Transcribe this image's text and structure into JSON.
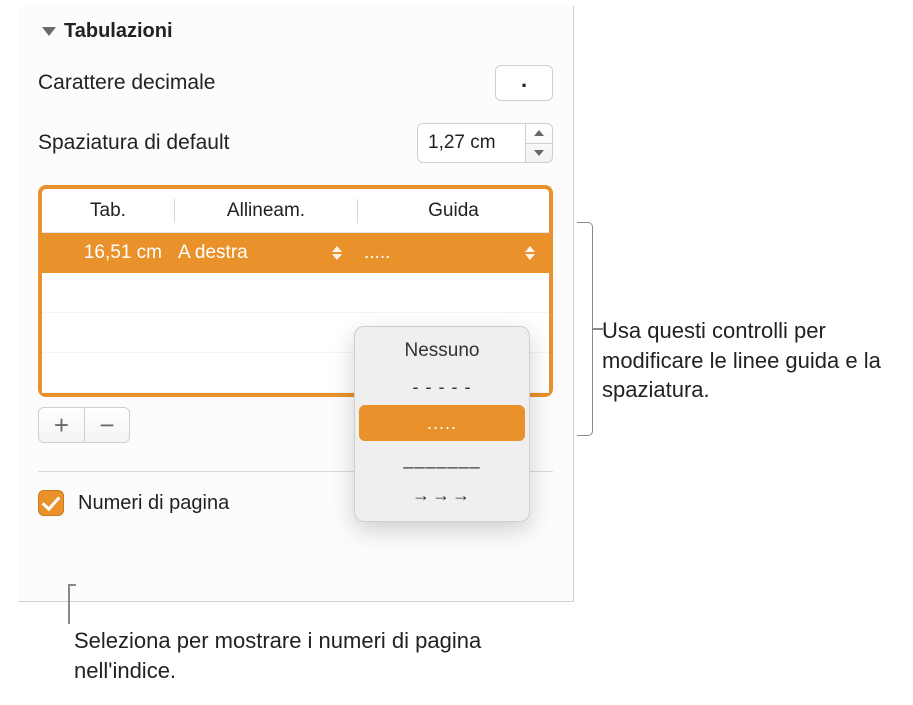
{
  "section": {
    "title": "Tabulazioni"
  },
  "decimal": {
    "label": "Carattere decimale",
    "value": "."
  },
  "spacing": {
    "label": "Spaziatura di default",
    "value": "1,27 cm"
  },
  "table": {
    "headers": {
      "tab": "Tab.",
      "align": "Allineam.",
      "leader": "Guida"
    },
    "row": {
      "stop": "16,51 cm",
      "align": "A destra",
      "leader": "....."
    }
  },
  "leader_options": {
    "none": "Nessuno",
    "dashes": "- - - - -",
    "dots": ".....",
    "underscore": "_______",
    "arrows": "→→→"
  },
  "page_numbers": {
    "label": "Numeri di pagina"
  },
  "callouts": {
    "right": "Usa questi controlli per modificare le linee guida e la spaziatura.",
    "bottom": "Seleziona per mostrare i numeri di pagina nell'indice."
  },
  "buttons": {
    "plus": "+",
    "minus": "−"
  }
}
